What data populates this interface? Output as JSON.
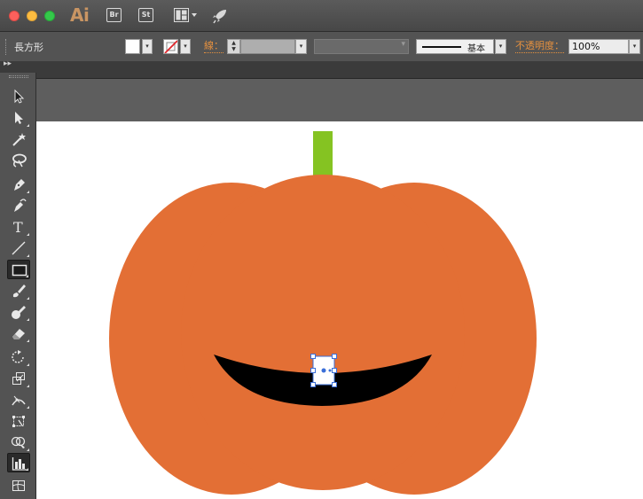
{
  "app": {
    "logo_text": "Ai",
    "bridge_label": "Br",
    "stock_label": "St"
  },
  "controlbar": {
    "tool_name": "長方形",
    "fill_color": "#ffffff",
    "stroke": "none",
    "stroke_label": "線：",
    "stroke_weight": "",
    "brush_label": "基本",
    "opacity_label": "不透明度：",
    "opacity_value": "100%"
  },
  "artwork": {
    "pumpkin_color": "#e36f35",
    "stem_color": "#85c322",
    "mouth_color": "#000000",
    "tooth_color": "#ffffff",
    "selection_color": "#3b6fd8"
  },
  "toolbar": {
    "tools": [
      "selection-tool",
      "direct-selection-tool",
      "magic-wand-tool",
      "lasso-tool",
      "pen-tool",
      "curvature-tool",
      "type-tool",
      "line-segment-tool",
      "rectangle-tool",
      "paintbrush-tool",
      "blob-brush-tool",
      "eraser-tool",
      "rotate-tool",
      "scale-tool",
      "width-tool",
      "free-transform-tool",
      "shape-builder-tool",
      "graph-tool",
      "mesh-tool"
    ],
    "active_tool": "graph-tool"
  }
}
